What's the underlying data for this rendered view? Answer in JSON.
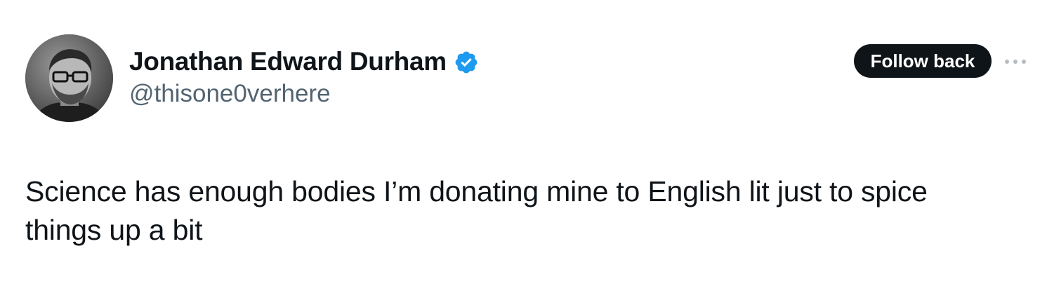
{
  "author": {
    "display_name": "Jonathan Edward Durham",
    "handle": "@thisone0verhere",
    "verified": true,
    "verified_color": "#1d9bf0",
    "avatar_icon": "profile-photo"
  },
  "actions": {
    "follow_label": "Follow back",
    "more_icon": "more-horizontal-icon"
  },
  "tweet": {
    "text": "Science has enough bodies I’m donating mine to English lit just to spice things up a bit"
  },
  "colors": {
    "text_primary": "#0f1419",
    "text_secondary": "#536471",
    "button_bg": "#0f1419",
    "button_text": "#ffffff"
  }
}
